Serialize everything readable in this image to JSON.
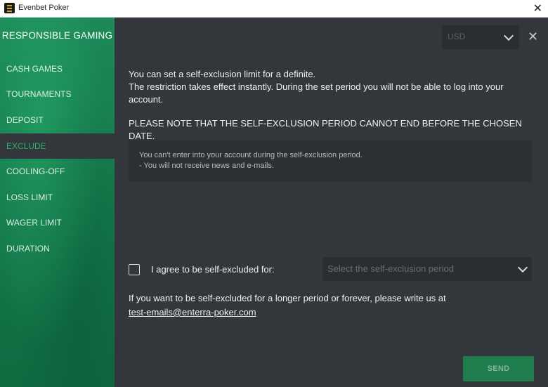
{
  "window": {
    "title": "Evenbet Poker",
    "close_icon": "close-icon"
  },
  "sidebar": {
    "heading": "RESPONSIBLE GAMING",
    "items": [
      {
        "label": "CASH GAMES"
      },
      {
        "label": "TOURNAMENTS"
      },
      {
        "label": "DEPOSIT"
      },
      {
        "label": "EXCLUDE",
        "active": true
      },
      {
        "label": "COOLING-OFF"
      },
      {
        "label": "LOSS LIMIT"
      },
      {
        "label": "WAGER LIMIT"
      },
      {
        "label": "DURATION"
      }
    ]
  },
  "main": {
    "currency": {
      "selected": "USD"
    },
    "intro_lines": [
      "You can set a self-exclusion limit for a definite.",
      "The restriction takes effect instantly. During the set period you will not be able to log into your account."
    ],
    "note": "PLEASE NOTE THAT THE SELF-EXCLUSION PERIOD CANNOT END BEFORE THE CHOSEN DATE.",
    "info_lines": [
      "You can't enter into your account during the self-exclusion period.",
      "- You will not receive news and e-mails."
    ],
    "agree_label": "I agree to be self-excluded for:",
    "period_select": {
      "placeholder": "Select the self-exclusion period"
    },
    "longer_text": "If you want to be self-excluded for a longer period or forever, please write us at",
    "email": "test-emails@enterra-poker.com",
    "send_label": "SEND"
  },
  "colors": {
    "sidebar_green": "#157a4c",
    "accent_green": "#27b26c",
    "panel_bg": "#33363b",
    "send_button": "#1f7d4e"
  }
}
